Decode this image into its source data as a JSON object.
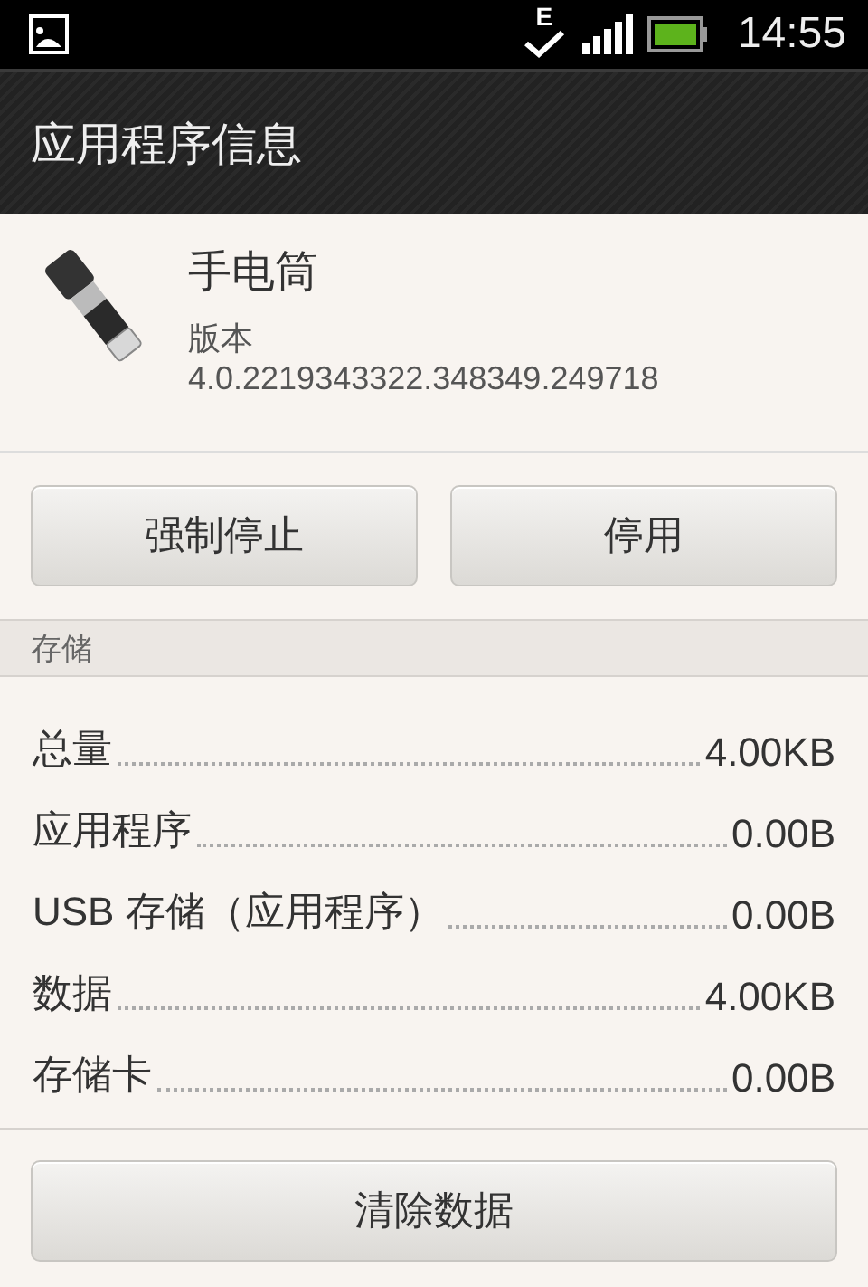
{
  "status_bar": {
    "network_type": "E",
    "time": "14:55"
  },
  "title_bar": {
    "title": "应用程序信息"
  },
  "app": {
    "name": "手电筒",
    "version_label": "版本",
    "version": "4.0.2219343322.348349.249718"
  },
  "action_buttons": [
    "强制停止",
    "停用"
  ],
  "storage": {
    "header": "存储",
    "rows": [
      {
        "label": "总量",
        "value": "4.00KB"
      },
      {
        "label": "应用程序",
        "value": "0.00B"
      },
      {
        "label": "USB 存储（应用程序）",
        "value": "0.00B"
      },
      {
        "label": "数据",
        "value": "4.00KB"
      },
      {
        "label": "存储卡",
        "value": "0.00B"
      }
    ],
    "clear_button": "清除数据"
  }
}
